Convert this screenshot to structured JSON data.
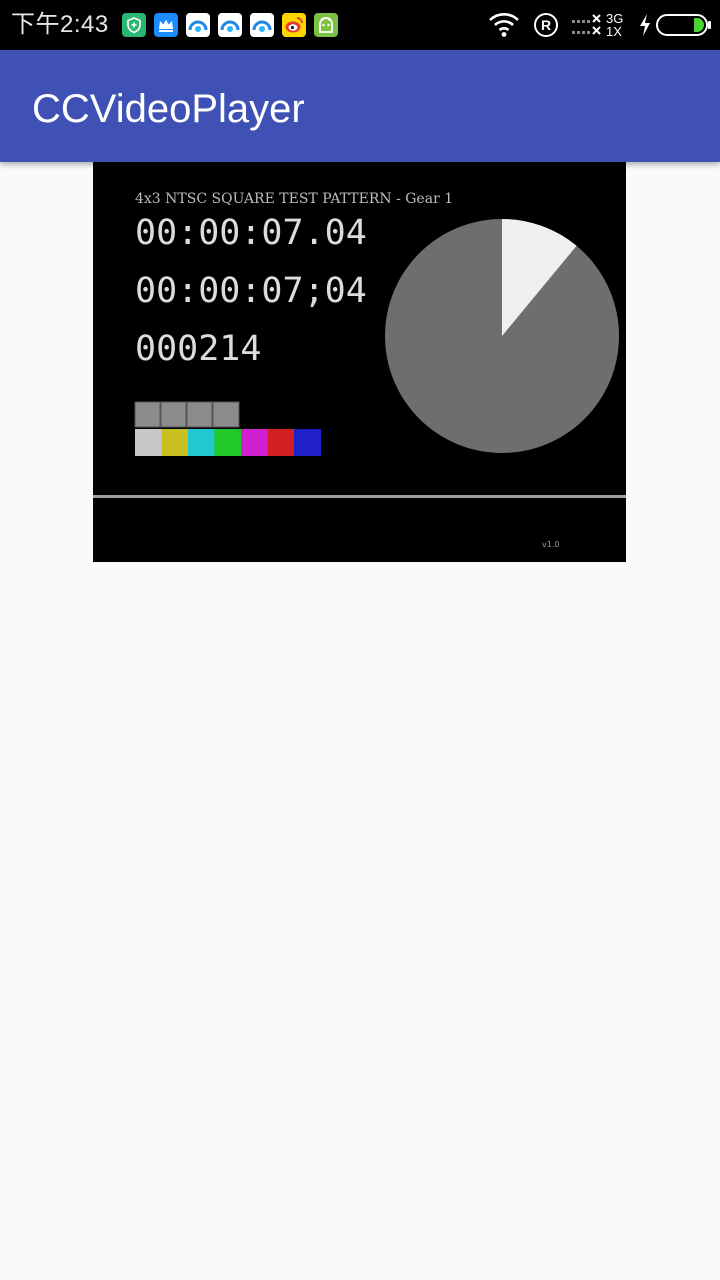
{
  "status_bar": {
    "time": "下午2:43",
    "network_type": "3G",
    "network_sub": "1X",
    "notification_icons": [
      "shield-icon",
      "crown-icon",
      "qq-browser-icon",
      "qq-browser-icon",
      "qq-browser-icon",
      "weibo-icon",
      "android-icon"
    ],
    "system_icons": [
      "wifi-icon",
      "registered-icon",
      "signal-icon",
      "charging-icon",
      "battery-icon"
    ],
    "colors": {
      "background": "#000000",
      "battery_fill": "#4cd137"
    }
  },
  "app_bar": {
    "title": "CCVideoPlayer",
    "color": "#3f51b5"
  },
  "video": {
    "header_text": "4x3 NTSC SQUARE TEST PATTERN - Gear 1",
    "timecode_1": "00:00:07.04",
    "timecode_2": "00:00:07;04",
    "frame_count": "000214",
    "version_text": "v1.0",
    "pie_progress": 0.11,
    "color_bars": [
      "#c8c8c8",
      "#c8c020",
      "#20c8d0",
      "#20c828",
      "#d020d0",
      "#d02020",
      "#2020c8"
    ]
  }
}
